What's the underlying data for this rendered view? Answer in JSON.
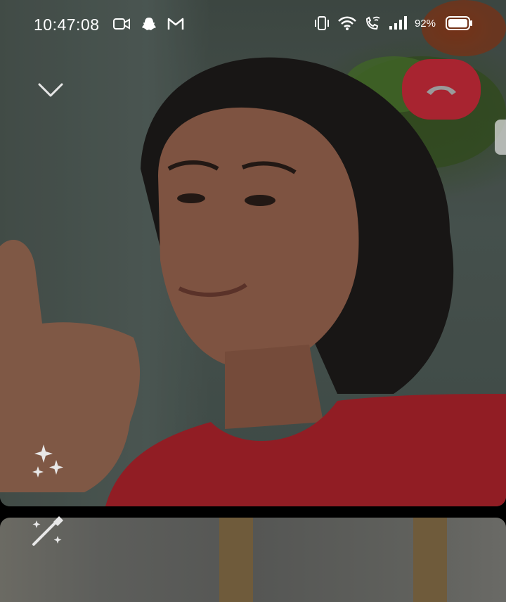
{
  "status_bar": {
    "time": "10:47:08",
    "battery_percent": "92%",
    "left_icons": [
      "video-camera-icon",
      "snapchat-icon",
      "gmail-icon"
    ],
    "right_icons": [
      "vibrate-icon",
      "wifi-icon",
      "wifi-calling-icon",
      "signal-icon",
      "battery-icon"
    ]
  },
  "call": {
    "controls": [
      "minimize",
      "end-call",
      "effects"
    ],
    "end_call_color": "#a82430"
  }
}
